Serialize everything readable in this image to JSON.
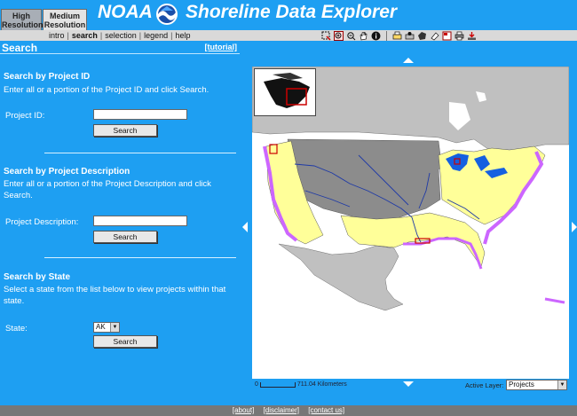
{
  "header": {
    "resolution_tabs": [
      {
        "line1": "High",
        "line2": "Resolution"
      },
      {
        "line1": "Medium",
        "line2": "Resolution"
      }
    ],
    "title_part1": "NOAA",
    "title_part2": "Shoreline Data Explorer"
  },
  "nav": {
    "links": [
      "intro",
      "search",
      "selection",
      "legend",
      "help"
    ],
    "active": "search"
  },
  "toolbar": {
    "icons": [
      "select-rectangle-icon",
      "zoom-in-icon",
      "zoom-out-icon",
      "pan-hand-icon",
      "identify-icon",
      "print-icon",
      "save-icon",
      "bookmark-icon",
      "erase-icon",
      "layers-icon",
      "printer-icon",
      "download-icon"
    ]
  },
  "panel": {
    "title": "Search",
    "tutorial": "[tutorial]",
    "project_id": {
      "heading": "Search by Project ID",
      "description": "Enter all or a portion of the Project ID and click Search.",
      "label": "Project ID:",
      "button": "Search"
    },
    "project_description": {
      "heading": "Search by Project Description",
      "description": "Enter all or a portion of the Project Description and click Search.",
      "label": "Project Description:",
      "button": "Search"
    },
    "state": {
      "heading": "Search by State",
      "description": "Select a state from the list below to view projects within that state.",
      "label": "State:",
      "selected": "AK",
      "button": "Search"
    }
  },
  "map": {
    "scale_start": "0",
    "scale_text": "711.04 Kilometers",
    "active_layer_label": "Active Layer:",
    "active_layer_value": "Projects",
    "colors": {
      "water": "#ffffff",
      "land": "#c0c0c0",
      "shoreline_states": "#ffff99",
      "inland_states": "#8c8c8c",
      "rivers": "#1f3aa6",
      "projects": "#cc66ff",
      "selected": "#cc0000"
    }
  },
  "footer": {
    "links": [
      "[about]",
      "[disclaimer]",
      "[contact us]"
    ]
  }
}
